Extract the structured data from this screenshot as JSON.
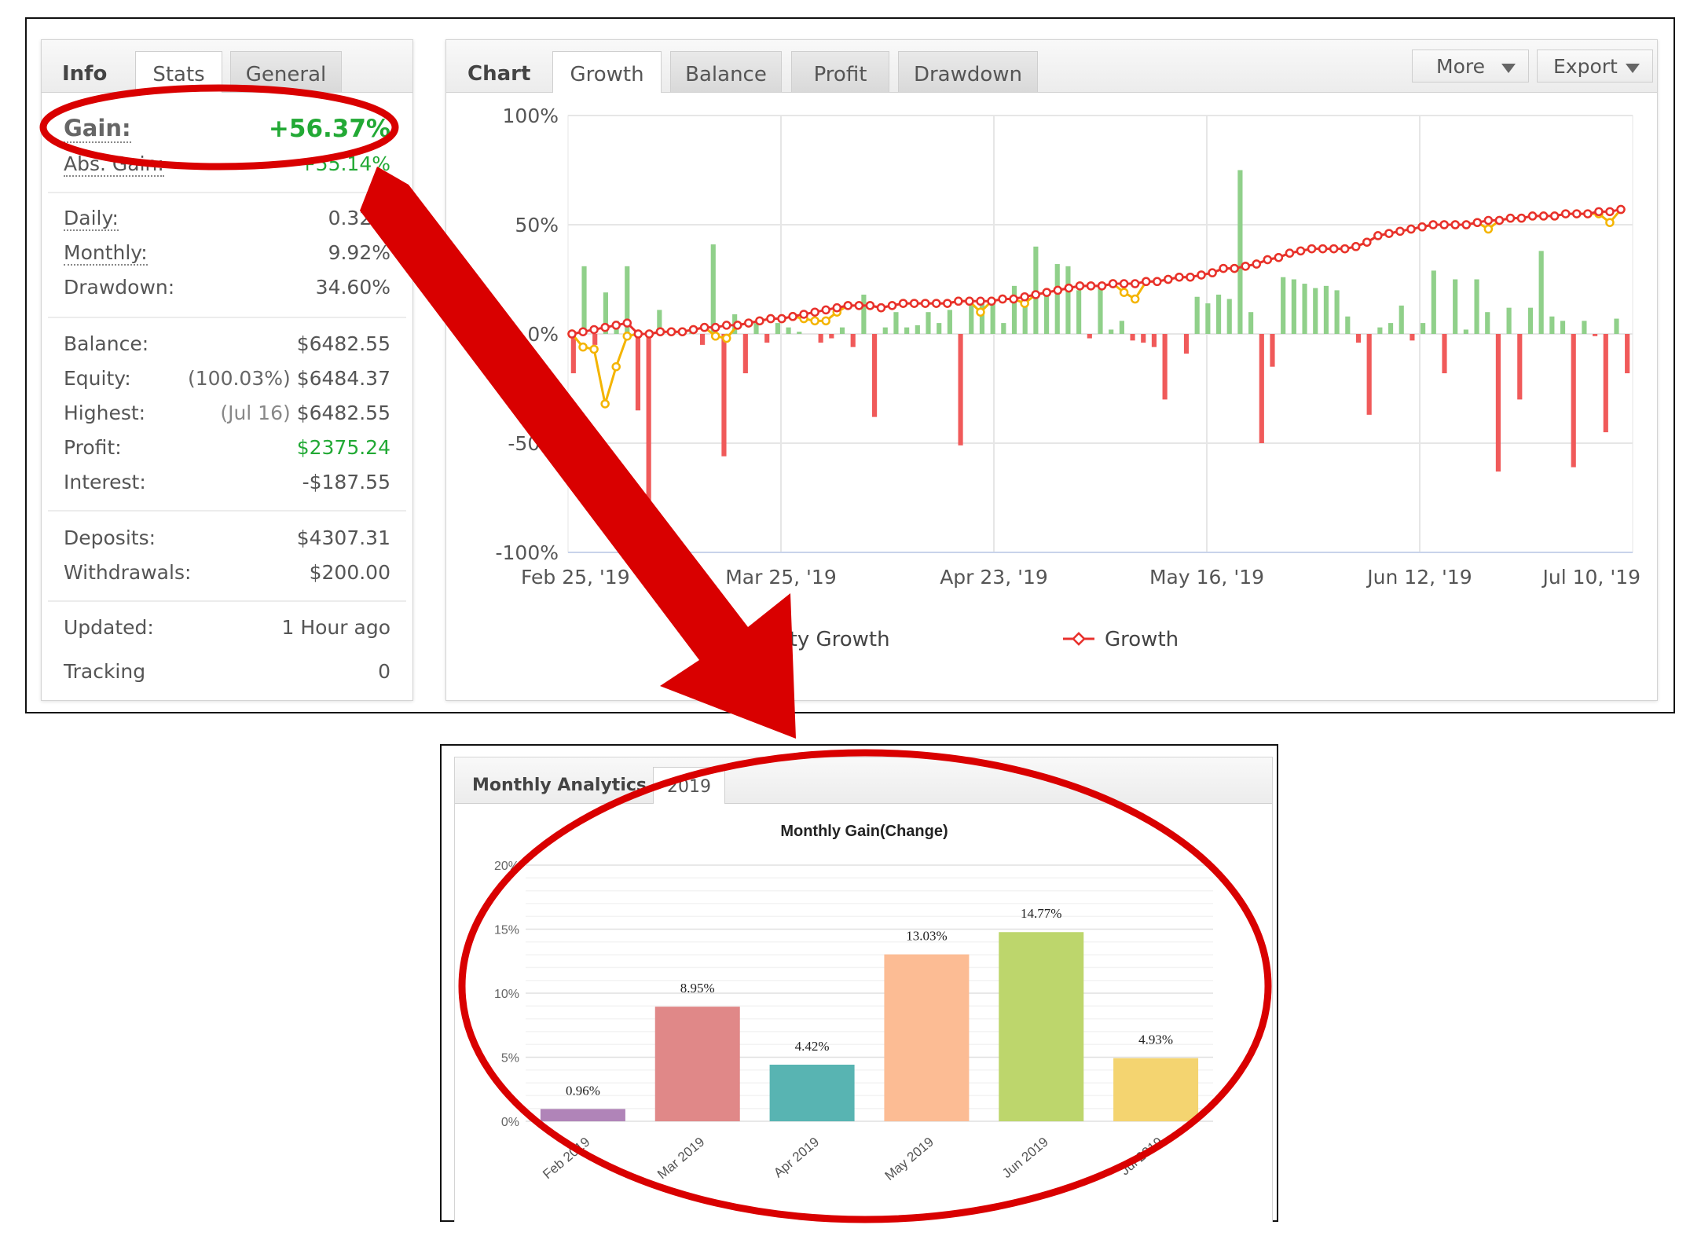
{
  "info": {
    "tabs": [
      "Info",
      "Stats",
      "General"
    ],
    "gain": {
      "label": "Gain:",
      "value": "+56.37%"
    },
    "abs_gain": {
      "label": "Abs. Gain:",
      "value": "+55.14%"
    },
    "daily": {
      "label": "Daily:",
      "value": "0.32%"
    },
    "monthly": {
      "label": "Monthly:",
      "value": "9.92%"
    },
    "drawdown": {
      "label": "Drawdown:",
      "value": "34.60%"
    },
    "balance": {
      "label": "Balance:",
      "value": "$6482.55"
    },
    "equity": {
      "label": "Equity:",
      "prefix": "(100.03%)",
      "value": "$6484.37"
    },
    "highest": {
      "label": "Highest:",
      "prefix": "(Jul 16)",
      "value": "$6482.55"
    },
    "profit": {
      "label": "Profit:",
      "value": "$2375.24"
    },
    "interest": {
      "label": "Interest:",
      "value": "-$187.55"
    },
    "deposits": {
      "label": "Deposits:",
      "value": "$4307.31"
    },
    "withdrawals": {
      "label": "Withdrawals:",
      "value": "$200.00"
    },
    "updated": {
      "label": "Updated:",
      "value": "1 Hour ago"
    },
    "tracking": {
      "label": "Tracking",
      "value": "0"
    }
  },
  "chart_panel": {
    "title": "Chart",
    "tabs": [
      "Growth",
      "Balance",
      "Profit",
      "Drawdown"
    ],
    "active_tab": "Growth",
    "more_label": "More",
    "export_label": "Export",
    "legend": {
      "equity": "Equity Growth",
      "growth": "Growth"
    }
  },
  "monthly_analytics": {
    "title": "Monthly Analytics",
    "year_tab": "2019"
  },
  "colors": {
    "gain_green": "#22a935",
    "bar_positive": "#90d08a",
    "bar_negative": "#f05a5a",
    "growth_line": "#e8302c",
    "equity_line": "#f4b400",
    "annotation_red": "#d90000"
  },
  "chart_data": [
    {
      "type": "bar",
      "title": "",
      "y_ticks": [
        "100%",
        "50%",
        "0%",
        "-50%",
        "-100%"
      ],
      "x_ticks": [
        "Feb 25, '19",
        "Mar 25, '19",
        "Apr 23, '19",
        "May 16, '19",
        "Jun 12, '19",
        "Jul 10, '19"
      ],
      "ylim": [
        -100,
        100
      ],
      "daily_change_pct": [
        -18,
        31,
        -5,
        19,
        6,
        31,
        -35,
        -83,
        11,
        0,
        0,
        3,
        -5,
        41,
        -56,
        9,
        -18,
        5,
        -4,
        5,
        3,
        1,
        0,
        -4,
        -2,
        3,
        -6,
        18,
        -38,
        3,
        10,
        3,
        4,
        10,
        5,
        11,
        -51,
        14,
        14,
        16,
        5,
        22,
        13,
        40,
        18,
        32,
        31,
        20,
        -2,
        21,
        2,
        6,
        -3,
        -4,
        -6,
        -30,
        0,
        -9,
        17,
        14,
        18,
        16,
        75,
        10,
        -50,
        -15,
        26,
        25,
        23,
        21,
        22,
        20,
        8,
        -4,
        -37,
        3,
        5,
        13,
        -3,
        5,
        29,
        -18,
        25,
        2,
        25,
        10,
        -63,
        12,
        -30,
        12,
        38,
        8,
        6,
        -61,
        6,
        -1,
        -45,
        7,
        -18
      ],
      "growth_pct": [
        0,
        1,
        2,
        3,
        4,
        5,
        0,
        0,
        1,
        1,
        1,
        2,
        3,
        3,
        4,
        4,
        5,
        6,
        7,
        7,
        8,
        9,
        10,
        11,
        12,
        13,
        13,
        13,
        12,
        13,
        14,
        14,
        14,
        14,
        14,
        15,
        15,
        15,
        15,
        16,
        16,
        17,
        18,
        19,
        20,
        21,
        22,
        22,
        22,
        23,
        23,
        23,
        24,
        24,
        25,
        26,
        26,
        27,
        28,
        30,
        30,
        31,
        32,
        34,
        35,
        37,
        38,
        39,
        39,
        39,
        39,
        40,
        42,
        45,
        46,
        47,
        48,
        49,
        50,
        50,
        50,
        50,
        51,
        52,
        52,
        53,
        53,
        54,
        54,
        54,
        55,
        55,
        55,
        56,
        56,
        57
      ],
      "equity_growth_pct": [
        0,
        -6,
        -7,
        -32,
        -15,
        -1,
        0,
        0,
        1,
        1,
        1,
        2,
        3,
        -1,
        -2,
        4,
        5,
        6,
        7,
        7,
        8,
        7,
        6,
        6,
        10,
        13,
        13,
        13,
        12,
        13,
        14,
        14,
        14,
        14,
        14,
        15,
        15,
        10,
        15,
        16,
        16,
        14,
        18,
        19,
        20,
        21,
        22,
        22,
        22,
        23,
        19,
        16,
        24,
        24,
        25,
        26,
        26,
        27,
        28,
        30,
        30,
        31,
        32,
        34,
        35,
        37,
        38,
        39,
        39,
        39,
        39,
        40,
        42,
        45,
        46,
        47,
        48,
        49,
        50,
        50,
        50,
        50,
        51,
        48,
        52,
        53,
        53,
        54,
        54,
        54,
        55,
        55,
        55,
        55,
        51,
        57
      ]
    },
    {
      "type": "bar",
      "title": "Monthly Gain(Change)",
      "categories": [
        "Feb 2019",
        "Mar 2019",
        "Apr 2019",
        "May 2019",
        "Jun 2019",
        "Jul 2019"
      ],
      "values": [
        0.96,
        8.95,
        4.42,
        13.03,
        14.77,
        4.93
      ],
      "labels": [
        "0.96%",
        "8.95%",
        "4.42%",
        "13.03%",
        "14.77%",
        "4.93%"
      ],
      "bar_colors": [
        "#b084b8",
        "#e08888",
        "#58b4b2",
        "#fcbc94",
        "#bdd66c",
        "#f4d470"
      ],
      "y_ticks": [
        "20%",
        "15%",
        "10%",
        "5%",
        "0%"
      ],
      "ylim": [
        0,
        20
      ]
    }
  ]
}
